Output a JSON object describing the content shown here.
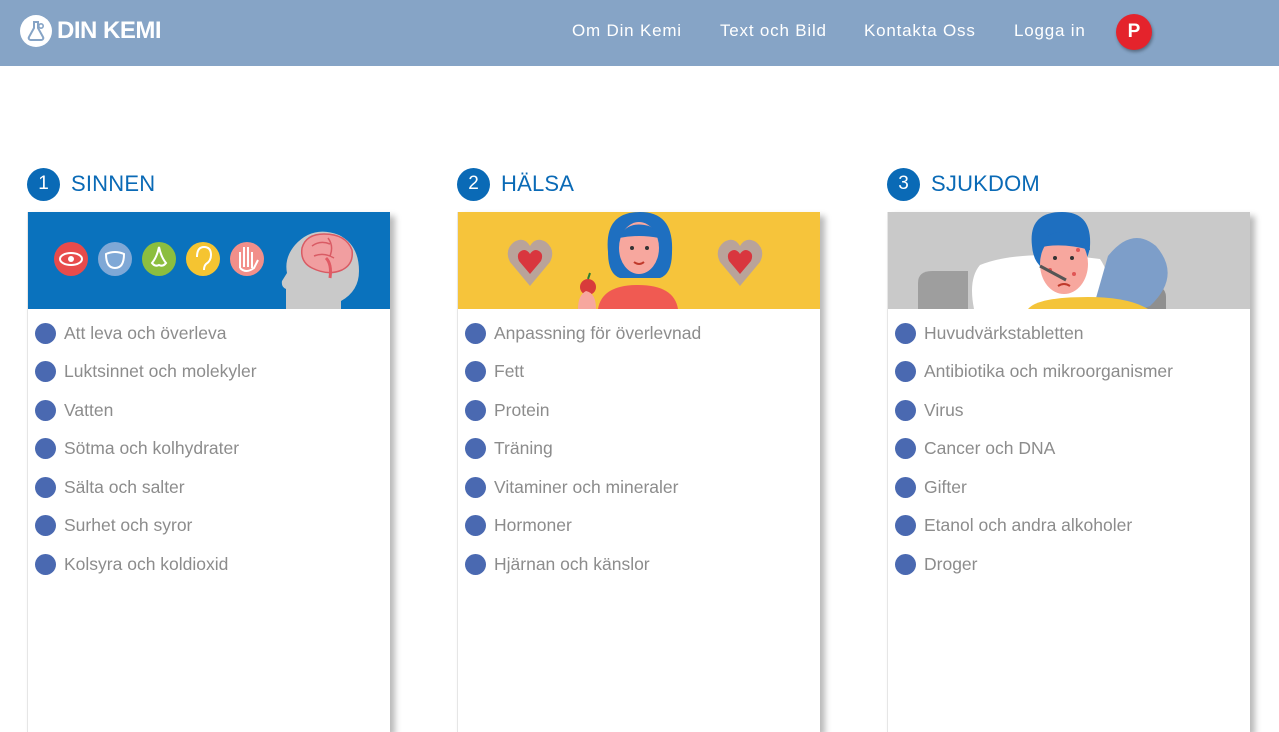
{
  "header": {
    "logo_text": "DIN KEMI",
    "nav": [
      "Om Din Kemi",
      "Text och Bild",
      "Kontakta Oss",
      "Logga in"
    ],
    "avatar_initial": "P"
  },
  "sections": [
    {
      "number": "1",
      "title": "SINNEN",
      "topics": [
        "Att leva och överleva",
        "Luktsinnet och molekyler",
        "Vatten",
        "Sötma och kolhydrater",
        "Sälta och salter",
        "Surhet och syror",
        "Kolsyra och koldioxid"
      ]
    },
    {
      "number": "2",
      "title": "HÄLSA",
      "topics": [
        "Anpassning för överlevnad",
        "Fett",
        "Protein",
        "Träning",
        "Vitaminer och mineraler",
        "Hormoner",
        "Hjärnan och känslor"
      ]
    },
    {
      "number": "3",
      "title": "SJUKDOM",
      "topics": [
        "Huvudvärkstabletten",
        "Antibiotika och mikroorganismer",
        "Virus",
        "Cancer och DNA",
        "Gifter",
        "Etanol och andra alkoholer",
        "Droger"
      ]
    }
  ],
  "colors": {
    "header_bg": "#86a4c6",
    "accent_blue": "#0a6ab6",
    "bullet": "#4a69b1",
    "avatar": "#e4232c",
    "banner_sinnen": "#0a72bd",
    "banner_halsa": "#f6c43b",
    "banner_sjukdom": "#c9c9c9"
  },
  "icons": [
    "flask-logo-icon",
    "eye-icon",
    "tongue-icon",
    "nose-icon",
    "ear-icon",
    "hand-icon",
    "brain-illustration",
    "heart-icon",
    "woman-illustration",
    "sick-person-illustration"
  ]
}
